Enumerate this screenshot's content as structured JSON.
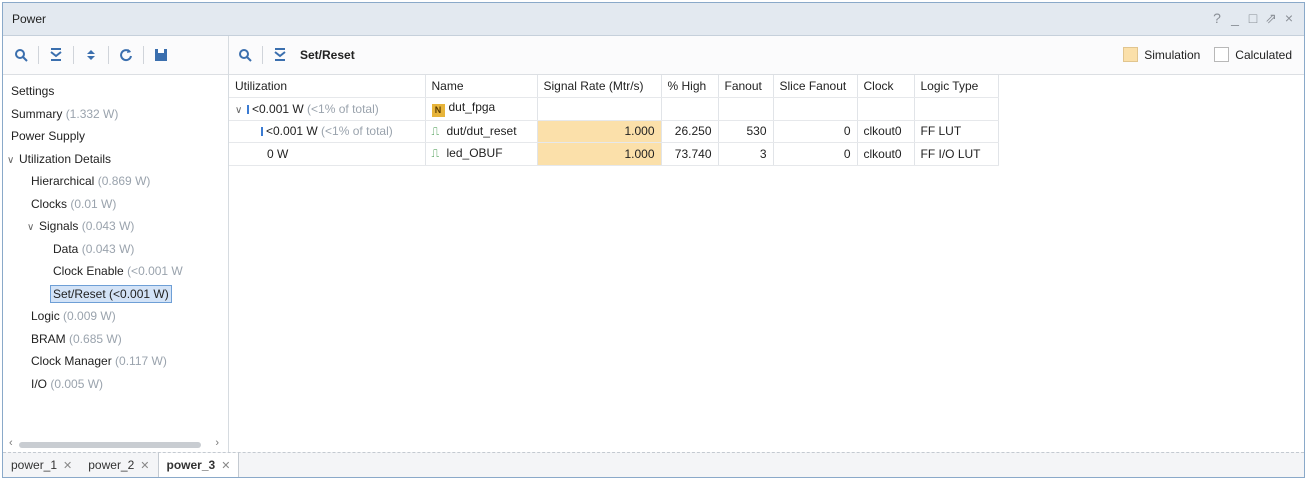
{
  "window": {
    "title": "Power",
    "controls": [
      "?",
      "_",
      "□",
      "⇗",
      "×"
    ]
  },
  "left_toolbar": {
    "icons": [
      "search-icon",
      "collapse-all-icon",
      "expand-all-icon",
      "refresh-icon",
      "save-icon"
    ]
  },
  "tree": {
    "settings": "Settings",
    "summary": {
      "label": "Summary",
      "value": "(1.332 W)"
    },
    "power_supply": "Power Supply",
    "utilization_details": "Utilization Details",
    "hierarchical": {
      "label": "Hierarchical",
      "value": "(0.869 W)"
    },
    "clocks": {
      "label": "Clocks",
      "value": "(0.01 W)"
    },
    "signals": {
      "label": "Signals",
      "value": "(0.043 W)"
    },
    "data": {
      "label": "Data",
      "value": "(0.043 W)"
    },
    "clock_enable": {
      "label": "Clock Enable",
      "value": "(<0.001 W"
    },
    "set_reset": "Set/Reset (<0.001 W)",
    "logic": {
      "label": "Logic",
      "value": "(0.009 W)"
    },
    "bram": {
      "label": "BRAM",
      "value": "(0.685 W)"
    },
    "clock_manager": {
      "label": "Clock Manager",
      "value": "(0.117 W)"
    },
    "io": {
      "label": "I/O",
      "value": "(0.005 W)"
    }
  },
  "right_toolbar": {
    "crumb": "Set/Reset"
  },
  "legend": {
    "simulation": "Simulation",
    "calculated": "Calculated",
    "simulation_color": "#fbe0aa"
  },
  "table": {
    "headers": [
      "Utilization",
      "Name",
      "Signal Rate (Mtr/s)",
      "% High",
      "Fanout",
      "Slice Fanout",
      "Clock",
      "Logic Type"
    ],
    "rows": [
      {
        "util": "<0.001 W",
        "util_pct": "(<1% of total)",
        "name": "dut_fpga",
        "rate": "",
        "high": "",
        "fanout": "",
        "slice": "",
        "clock": "",
        "logic": ""
      },
      {
        "util": "<0.001 W",
        "util_pct": "(<1% of total)",
        "name": "dut/dut_reset",
        "rate": "1.000",
        "high": "26.250",
        "fanout": "530",
        "slice": "0",
        "clock": "clkout0",
        "logic": "FF LUT"
      },
      {
        "util": "0 W",
        "util_pct": "",
        "name": "led_OBUF",
        "rate": "1.000",
        "high": "73.740",
        "fanout": "3",
        "slice": "0",
        "clock": "clkout0",
        "logic": "FF I/O LUT"
      }
    ]
  },
  "tabs": [
    "power_1",
    "power_2",
    "power_3"
  ]
}
